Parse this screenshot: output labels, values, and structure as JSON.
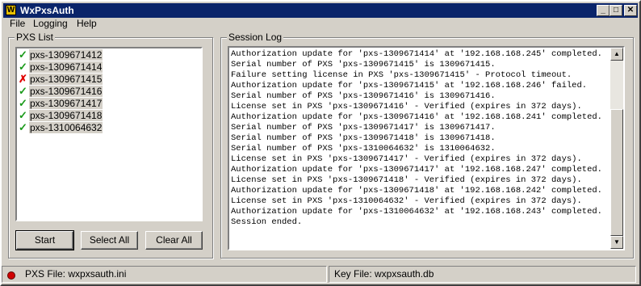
{
  "window": {
    "title": "WxPxsAuth",
    "controls": {
      "minimize": "_",
      "maximize": "□",
      "close": "✕"
    }
  },
  "menu": [
    {
      "label": "File"
    },
    {
      "label": "Logging"
    },
    {
      "label": "Help"
    }
  ],
  "pxs_list": {
    "label": "PXS List",
    "items": [
      {
        "name": "pxs-1309671412",
        "status": "ok",
        "icon": "check-icon"
      },
      {
        "name": "pxs-1309671414",
        "status": "ok",
        "icon": "check-icon"
      },
      {
        "name": "pxs-1309671415",
        "status": "error",
        "icon": "cross-icon"
      },
      {
        "name": "pxs-1309671416",
        "status": "ok",
        "icon": "check-icon"
      },
      {
        "name": "pxs-1309671417",
        "status": "ok",
        "icon": "check-icon"
      },
      {
        "name": "pxs-1309671418",
        "status": "ok",
        "icon": "check-icon"
      },
      {
        "name": "pxs-1310064632",
        "status": "ok",
        "icon": "check-icon"
      }
    ],
    "buttons": {
      "start": "Start",
      "select_all": "Select All",
      "clear_all": "Clear All"
    }
  },
  "session_log": {
    "label": "Session Log",
    "lines": [
      "Authorization update for 'pxs-1309671414' at '192.168.168.245' completed.",
      "Serial number of PXS 'pxs-1309671415' is 1309671415.",
      "Failure setting license in PXS 'pxs-1309671415' - Protocol timeout.",
      "Authorization update for 'pxs-1309671415' at '192.168.168.246' failed.",
      "Serial number of PXS 'pxs-1309671416' is 1309671416.",
      "License set in PXS 'pxs-1309671416' - Verified (expires in 372 days).",
      "Authorization update for 'pxs-1309671416' at '192.168.168.241' completed.",
      "Serial number of PXS 'pxs-1309671417' is 1309671417.",
      "Serial number of PXS 'pxs-1309671418' is 1309671418.",
      "Serial number of PXS 'pxs-1310064632' is 1310064632.",
      "License set in PXS 'pxs-1309671417' - Verified (expires in 372 days).",
      "Authorization update for 'pxs-1309671417' at '192.168.168.247' completed.",
      "License set in PXS 'pxs-1309671418' - Verified (expires in 372 days).",
      "Authorization update for 'pxs-1309671418' at '192.168.168.242' completed.",
      "License set in PXS 'pxs-1310064632' - Verified (expires in 372 days).",
      "Authorization update for 'pxs-1310064632' at '192.168.168.243' completed.",
      "Session ended."
    ]
  },
  "status_bar": {
    "pxs_file": "PXS File: wxpxsauth.ini",
    "key_file": "Key File: wxpxsauth.db",
    "indicator_color": "#d00000"
  },
  "colors": {
    "titlebar": "#0a246a",
    "ok": "#1a9a1a",
    "error": "#e00000"
  }
}
